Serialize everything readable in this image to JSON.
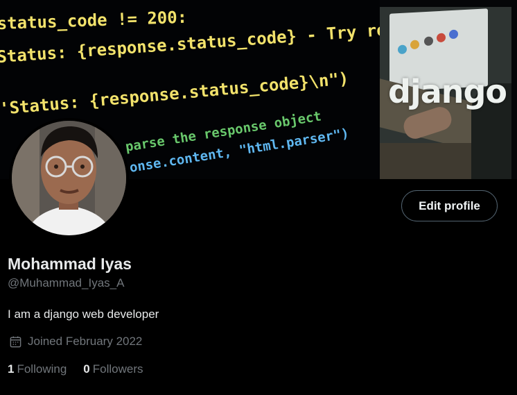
{
  "banner": {
    "code_lines": [
      "status_code != 200:",
      "Status: {response.status_code} - Try rerunning the code\\n')",
      "'Status: {response.status_code}\\n\")",
      "parse the response object",
      "onse.content, \"html.parser\")"
    ],
    "logo_text": "django"
  },
  "profile": {
    "name": "Mohammad Iyas",
    "handle": "@Muhammad_Iyas_A",
    "bio": "I am a django web developer",
    "joined": "Joined February 2022",
    "edit_label": "Edit profile",
    "following_count": "1",
    "following_label": "Following",
    "followers_count": "0",
    "followers_label": "Followers"
  },
  "icons": {
    "joined": "calendar-icon"
  },
  "colors": {
    "background": "#000000",
    "text_primary": "#e7e9ea",
    "text_secondary": "#71767b",
    "button_border": "#536471",
    "code_yellow": "#f2e26b",
    "code_blue": "#5fb7f0",
    "code_green": "#69c86c",
    "code_red": "#e2533f"
  }
}
